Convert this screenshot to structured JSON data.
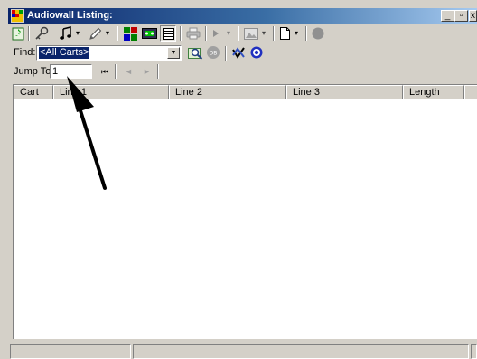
{
  "window": {
    "title": "Audiowall Listing:",
    "minimize_glyph": "_",
    "restore_glyph": "▫",
    "close_glyph": "x"
  },
  "toolbar": {
    "icons": [
      "refresh-icon",
      "key-icon",
      "music-note-icon",
      "pencil-icon",
      "color-grid-icon",
      "tape-icon",
      "list-view-icon",
      "printer-icon",
      "play-icon",
      "picture-icon",
      "new-document-icon",
      "record-icon"
    ],
    "dropdown_glyph": "▾"
  },
  "find": {
    "label": "Find:",
    "value": "<All Carts>",
    "arrow_glyph": "▼"
  },
  "jump": {
    "label": "Jump To:",
    "value": "1",
    "first_glyph": "⏮",
    "prev_glyph": "◄",
    "next_glyph": "►"
  },
  "list": {
    "columns": [
      "Cart",
      "Line 1",
      "Line 2",
      "Line 3",
      "Length"
    ]
  },
  "colors": {
    "title_bar": "#0a246a",
    "face": "#d4d0c8",
    "selection": "#0a246a"
  }
}
